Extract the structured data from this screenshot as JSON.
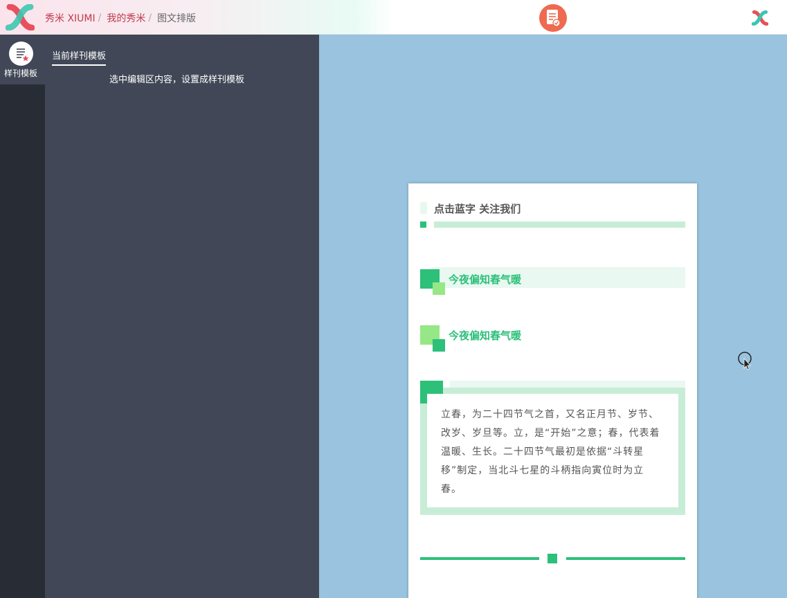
{
  "header": {
    "breadcrumb": [
      {
        "label": "秀米 XIUMI",
        "sep": "/"
      },
      {
        "label": "我的秀米",
        "sep": "/"
      },
      {
        "label": "图文排版"
      }
    ],
    "icons": {
      "logo": "xiumi-logo-icon",
      "doc_action": "document-check-icon",
      "brand": "xiumi-logo-icon"
    }
  },
  "rail": {
    "items": [
      {
        "label": "样刊模板",
        "icon": "template-star-icon"
      }
    ]
  },
  "panel": {
    "tab": "当前样刊模板",
    "hint": "选中编辑区内容，设置成样刊模板"
  },
  "article": {
    "follow": "点击蓝字 关注我们",
    "heading1": "今夜偏知春气暖",
    "heading2": "今夜偏知春气暖",
    "body": "立春，为二十四节气之首，又名正月节、岁节、改岁、岁旦等。立，是“开始”之意；春，代表着温暖、生长。二十四节气最初是依据“斗转星移”制定，当北斗七星的斗柄指向寅位时为立春。"
  },
  "colors": {
    "accent_green": "#2cc079",
    "light_green": "#96e785",
    "pale_green": "#c8edd7",
    "panel_bg": "#414756",
    "rail_bg": "#282c35",
    "canvas_bg": "#99c3de",
    "brand_red": "#c0394b",
    "doc_orange": "#ee6a50"
  }
}
